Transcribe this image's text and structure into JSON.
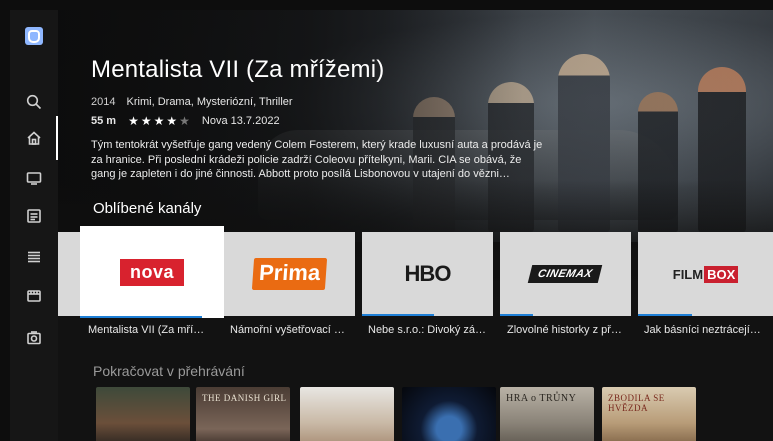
{
  "sidebar": {
    "items": [
      {
        "icon": "search-icon",
        "active": false
      },
      {
        "icon": "home-icon",
        "active": true
      },
      {
        "icon": "tv-icon",
        "active": false
      },
      {
        "icon": "guide-icon",
        "active": false
      },
      {
        "icon": "list-icon",
        "active": false
      },
      {
        "icon": "movie-icon",
        "active": false
      },
      {
        "icon": "recordings-icon",
        "active": false
      }
    ]
  },
  "hero": {
    "title": "Mentalista VII (Za mřížemi)",
    "year": "2014",
    "genres": "Krimi, Drama, Mysteriózní, Thriller",
    "duration": "55 m",
    "rating": 4,
    "rating_max": 5,
    "channel_date": "Nova 13.7.2022",
    "description": "Tým tentokrát vyšetřuje gang vedený Colem Fosterem, který krade luxusní auta a prodává je za hranice. Při poslední krádeži policie zadrží Coleovu přítelkyni, Marii. CIA se obává, že gang je zapleten i do jiné činnosti. Abbott proto posílá Lisbonovou v utajení do vězni…"
  },
  "favorites": {
    "heading": "Oblíbené kanály",
    "channels": [
      {
        "logo": "nova",
        "logo_text": "nova",
        "program": "Mentalista VII (Za mří…",
        "progress": 0.85,
        "selected": true
      },
      {
        "logo": "prima",
        "logo_text": "Prima",
        "program": "Námořní vyšetřovací …",
        "progress": 0.0,
        "selected": false
      },
      {
        "logo": "hbo",
        "logo_text": "HBO",
        "program": "Nebe s.r.o.: Divoký zá…",
        "progress": 0.55,
        "selected": false
      },
      {
        "logo": "cinemax",
        "logo_text": "CINEMAX",
        "program": "Zlovolné historky z př…",
        "progress": 0.25,
        "selected": false
      },
      {
        "logo": "filmbox",
        "logo_text_a": "FILM",
        "logo_text_b": "BOX",
        "program": "Jak básníci neztrácejí…",
        "progress": 0.4,
        "selected": false
      }
    ]
  },
  "continue": {
    "heading": "Pokračovat v přehrávání",
    "posters": [
      {
        "label": ""
      },
      {
        "label": "THE DANISH GIRL"
      },
      {
        "label": ""
      },
      {
        "label": ""
      },
      {
        "label": "HRA o TRŮNY"
      },
      {
        "label": "ZBODILA SE HVĚZDA"
      }
    ]
  }
}
